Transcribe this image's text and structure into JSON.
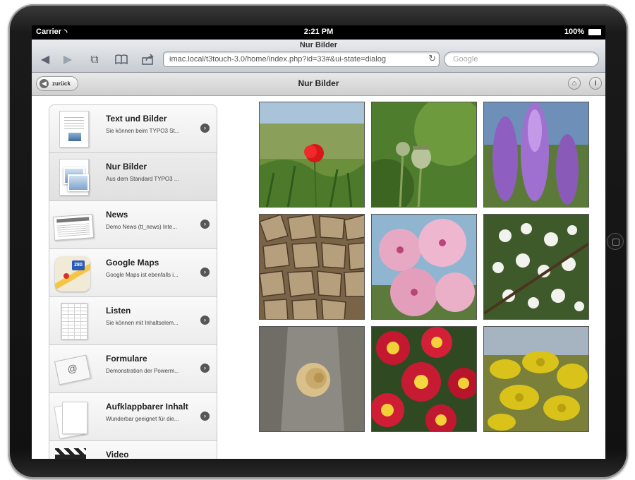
{
  "status_bar": {
    "carrier": "Carrier",
    "time": "2:21 PM",
    "battery": "100%"
  },
  "browser": {
    "page_title": "Nur Bilder",
    "url": "imac.local/t3touch-3.0/home/index.php?id=33#&ui-state=dialog",
    "search_placeholder": "Google",
    "icons": {
      "back": "back-arrow-icon",
      "forward": "forward-arrow-icon",
      "pages": "pages-icon",
      "bookmarks": "bookmarks-icon",
      "share": "share-icon",
      "reload": "reload-icon"
    }
  },
  "header": {
    "back_label": "zurück",
    "title": "Nur Bilder",
    "icons": [
      "home-icon",
      "info-icon"
    ]
  },
  "nav": {
    "items": [
      {
        "title": "Text und Bilder",
        "desc": "Sie können beim TYPO3 St...",
        "icon": "text-image-icon"
      },
      {
        "title": "Nur Bilder",
        "desc": "Aus dem Standard TYPO3 ...",
        "icon": "images-icon"
      },
      {
        "title": "News",
        "desc": "Demo News (tt_news) Inte...",
        "icon": "newspaper-icon"
      },
      {
        "title": "Google Maps",
        "desc": "Google Maps ist ebenfalls i...",
        "icon": "maps-icon"
      },
      {
        "title": "Listen",
        "desc": "Sie können mit Inhaltselem...",
        "icon": "list-icon"
      },
      {
        "title": "Formulare",
        "desc": "Demonstration der Powerm...",
        "icon": "envelope-icon"
      },
      {
        "title": "Aufklappbarer Inhalt",
        "desc": "Wunderbar geeignet für die...",
        "icon": "pages-icon"
      },
      {
        "title": "Video",
        "desc": "",
        "icon": "clapperboard-icon"
      }
    ],
    "active_index": 1,
    "maps_shield_number": "280"
  },
  "gallery": {
    "photos": [
      {
        "subject": "red poppy in meadow"
      },
      {
        "subject": "poppy seed heads"
      },
      {
        "subject": "purple lupins"
      },
      {
        "subject": "wooden shingles"
      },
      {
        "subject": "pink cherry blossoms"
      },
      {
        "subject": "white blossoms"
      },
      {
        "subject": "snail shell on bark"
      },
      {
        "subject": "red primroses"
      },
      {
        "subject": "yellow flowers"
      }
    ]
  },
  "colors": {
    "accent": "#5b6470",
    "header_bg": "#d9d9d9"
  }
}
